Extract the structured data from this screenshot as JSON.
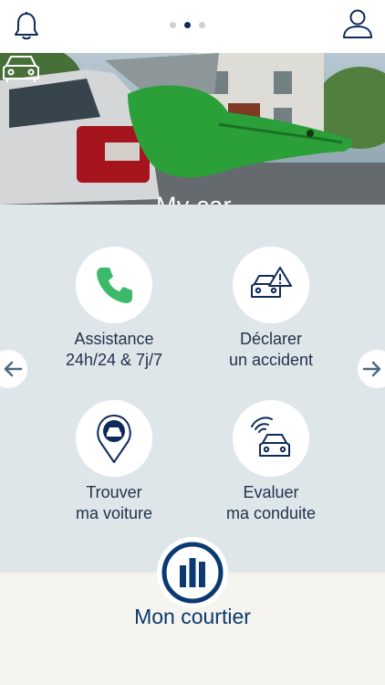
{
  "header": {
    "bell_icon": "bell-icon",
    "user_icon": "user-icon",
    "pager": {
      "count": 3,
      "active": 2
    }
  },
  "hero": {
    "title": "My car",
    "icon": "car-icon"
  },
  "tiles": [
    {
      "label_line1": "Assistance",
      "label_line2": "24h/24 & 7j/7",
      "icon": "phone-icon"
    },
    {
      "label_line1": "Déclarer",
      "label_line2": "un accident",
      "icon": "car-warning-icon"
    },
    {
      "label_line1": "Trouver",
      "label_line2": "ma voiture",
      "icon": "map-pin-car-icon"
    },
    {
      "label_line1": "Evaluer",
      "label_line2": "ma conduite",
      "icon": "car-signal-icon"
    }
  ],
  "nav": {
    "prev_icon": "arrow-left-icon",
    "next_icon": "arrow-right-icon"
  },
  "broker": {
    "label": "Mon courtier",
    "logo": "allianz-logo-icon"
  },
  "colors": {
    "accent": "#0e2a5a",
    "brand_blue": "#0b3a70",
    "phone_green": "#3db96b",
    "panel_bg": "#dfe6ea",
    "bottom_bg": "#f5f4ee"
  }
}
